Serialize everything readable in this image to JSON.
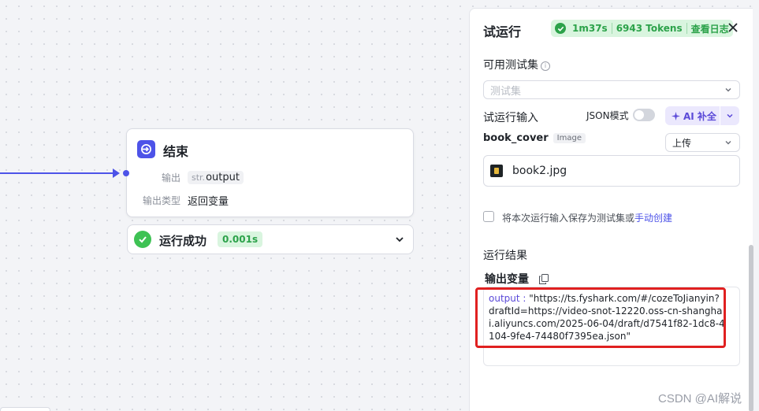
{
  "node": {
    "title": "结束",
    "output_label": "输出",
    "output_var_prefix": "str.",
    "output_var": "output",
    "type_label": "输出类型",
    "type_value": "返回变量"
  },
  "status": {
    "text": "运行成功",
    "duration": "0.001s"
  },
  "panel": {
    "title": "试运行",
    "run_time": "1m37s",
    "tokens": "6943 Tokens",
    "view_log": "查看日志",
    "testset_label": "可用测试集",
    "testset_placeholder": "测试集",
    "input_label": "试运行输入",
    "json_mode_label": "JSON模式",
    "ai_fill_label": "AI 补全",
    "field_name": "book_cover",
    "field_type": "Image",
    "upload_mode": "上传",
    "file_name": "book2.jpg",
    "save_text": "将本次运行输入保存为测试集或",
    "save_link": "手动创建",
    "result_label": "运行结果",
    "output_vars_label": "输出变量",
    "output_key": "output",
    "output_value": "\"https://ts.fyshark.com/#/cozeToJianyin?draftId=https://video-snot-12220.oss-cn-shanghai.aliyuncs.com/2025-06-04/draft/d7541f82-1dc8-4104-9fe4-74480f7395ea.json\""
  },
  "watermark": "CSDN @AI解说",
  "colors": {
    "accent": "#4d53e8",
    "success": "#3ec254",
    "highlight": "#e02020"
  }
}
